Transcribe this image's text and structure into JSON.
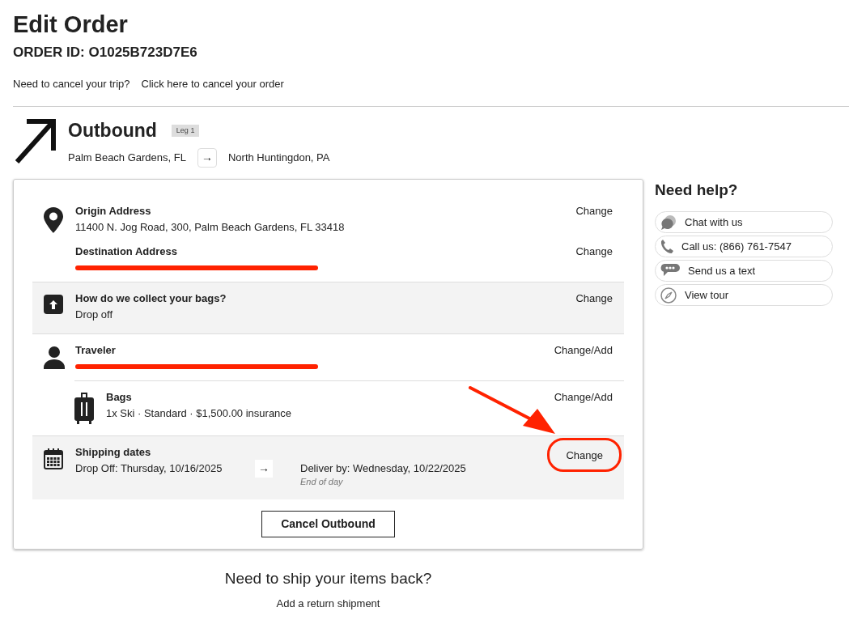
{
  "page": {
    "title": "Edit Order",
    "order_id": "ORDER ID: O1025B723D7E6",
    "cancel_prompt": "Need to cancel your trip?",
    "cancel_link": "Click here to cancel your order"
  },
  "leg": {
    "title": "Outbound",
    "badge": "Leg 1",
    "from": "Palm Beach Gardens, FL",
    "arrow": "→",
    "to": "North Huntingdon, PA"
  },
  "sections": [
    {
      "kind": "location",
      "shaded": false,
      "indented": false,
      "items": [
        {
          "label": "Origin Address",
          "value": "11400 N. Jog Road, 300, Palm Beach Gardens, FL 33418",
          "redacted": false,
          "action": "Change",
          "circled": false
        },
        {
          "label": "Destination Address",
          "redacted": true,
          "action": "Change",
          "circled": false
        }
      ]
    },
    {
      "kind": "collection",
      "shaded": true,
      "indented": false,
      "items": [
        {
          "label": "How do we collect your bags?",
          "value": "Drop off",
          "redacted": false,
          "action": "Change",
          "circled": false
        }
      ]
    },
    {
      "kind": "traveler",
      "shaded": false,
      "indented": false,
      "items": [
        {
          "label": "Traveler",
          "redacted": true,
          "action": "Change/Add",
          "circled": false
        }
      ]
    },
    {
      "kind": "bags",
      "shaded": false,
      "indented": true,
      "items": [
        {
          "label": "Bags",
          "value": "1x Ski · Standard · $1,500.00 insurance",
          "redacted": false,
          "action": "Change/Add",
          "circled": false
        }
      ]
    },
    {
      "kind": "dates",
      "shaded": true,
      "indented": false,
      "items": [
        {
          "label": "Shipping dates",
          "value": "Drop Off: Thursday, 10/16/2025",
          "arrow": "→",
          "deliver": "Deliver by: Wednesday, 10/22/2025",
          "note": "End of day",
          "redacted": false,
          "action": "Change",
          "circled": true
        }
      ]
    }
  ],
  "cancel_button": "Cancel Outbound",
  "return": {
    "title": "Need to ship your items back?",
    "link": "Add a return shipment"
  },
  "help": {
    "title": "Need help?",
    "buttons": [
      {
        "kind": "chat",
        "label": "Chat with us"
      },
      {
        "kind": "phone",
        "label": "Call us: (866) 761-7547"
      },
      {
        "kind": "text",
        "label": "Send us a text"
      },
      {
        "kind": "tour",
        "label": "View tour"
      }
    ]
  }
}
